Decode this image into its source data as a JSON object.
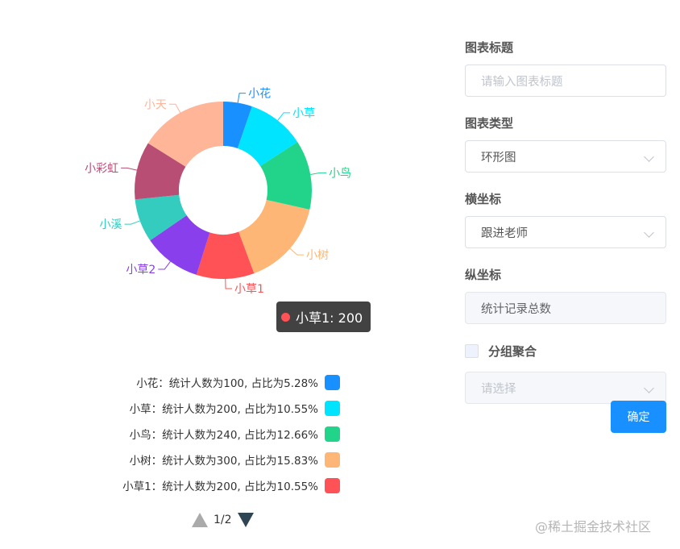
{
  "chart_data": {
    "type": "pie",
    "donut": true,
    "slices": [
      {
        "name": "小花",
        "value": 100,
        "color": "#1890ff"
      },
      {
        "name": "小草",
        "value": 200,
        "color": "#00e4ff"
      },
      {
        "name": "小鸟",
        "value": 240,
        "color": "#22d48a"
      },
      {
        "name": "小树",
        "value": 300,
        "color": "#fdb676"
      },
      {
        "name": "小草1",
        "value": 200,
        "color": "#ff5256"
      },
      {
        "name": "小草2",
        "value": 200,
        "color": "#8a3fed"
      },
      {
        "name": "小溪",
        "value": 150,
        "color": "#33ccbf"
      },
      {
        "name": "小彩虹",
        "value": 200,
        "color": "#b84e74"
      },
      {
        "name": "小天",
        "value": 305,
        "color": "#ffb598"
      }
    ]
  },
  "tooltip": {
    "text": "小草1: 200",
    "color": "#ff5256"
  },
  "legend": {
    "items": [
      {
        "text": "小花：统计人数为100, 占比为5.28%",
        "color": "#1890ff"
      },
      {
        "text": "小草：统计人数为200, 占比为10.55%",
        "color": "#00e4ff"
      },
      {
        "text": "小鸟：统计人数为240, 占比为12.66%",
        "color": "#22d48a"
      },
      {
        "text": "小树：统计人数为300, 占比为15.83%",
        "color": "#fdb676"
      },
      {
        "text": "小草1：统计人数为200, 占比为10.55%",
        "color": "#ff5256"
      }
    ],
    "page": "1/2"
  },
  "form": {
    "chart_title_label": "图表标题",
    "chart_title_placeholder": "请输入图表标题",
    "chart_type_label": "图表类型",
    "chart_type_value": "环形图",
    "x_axis_label": "横坐标",
    "x_axis_value": "跟进老师",
    "y_axis_label": "纵坐标",
    "y_axis_value": "统计记录总数",
    "group_label": "分组聚合",
    "group_placeholder": "请选择",
    "confirm_label": "确定"
  },
  "watermark": "@稀土掘金技术社区"
}
